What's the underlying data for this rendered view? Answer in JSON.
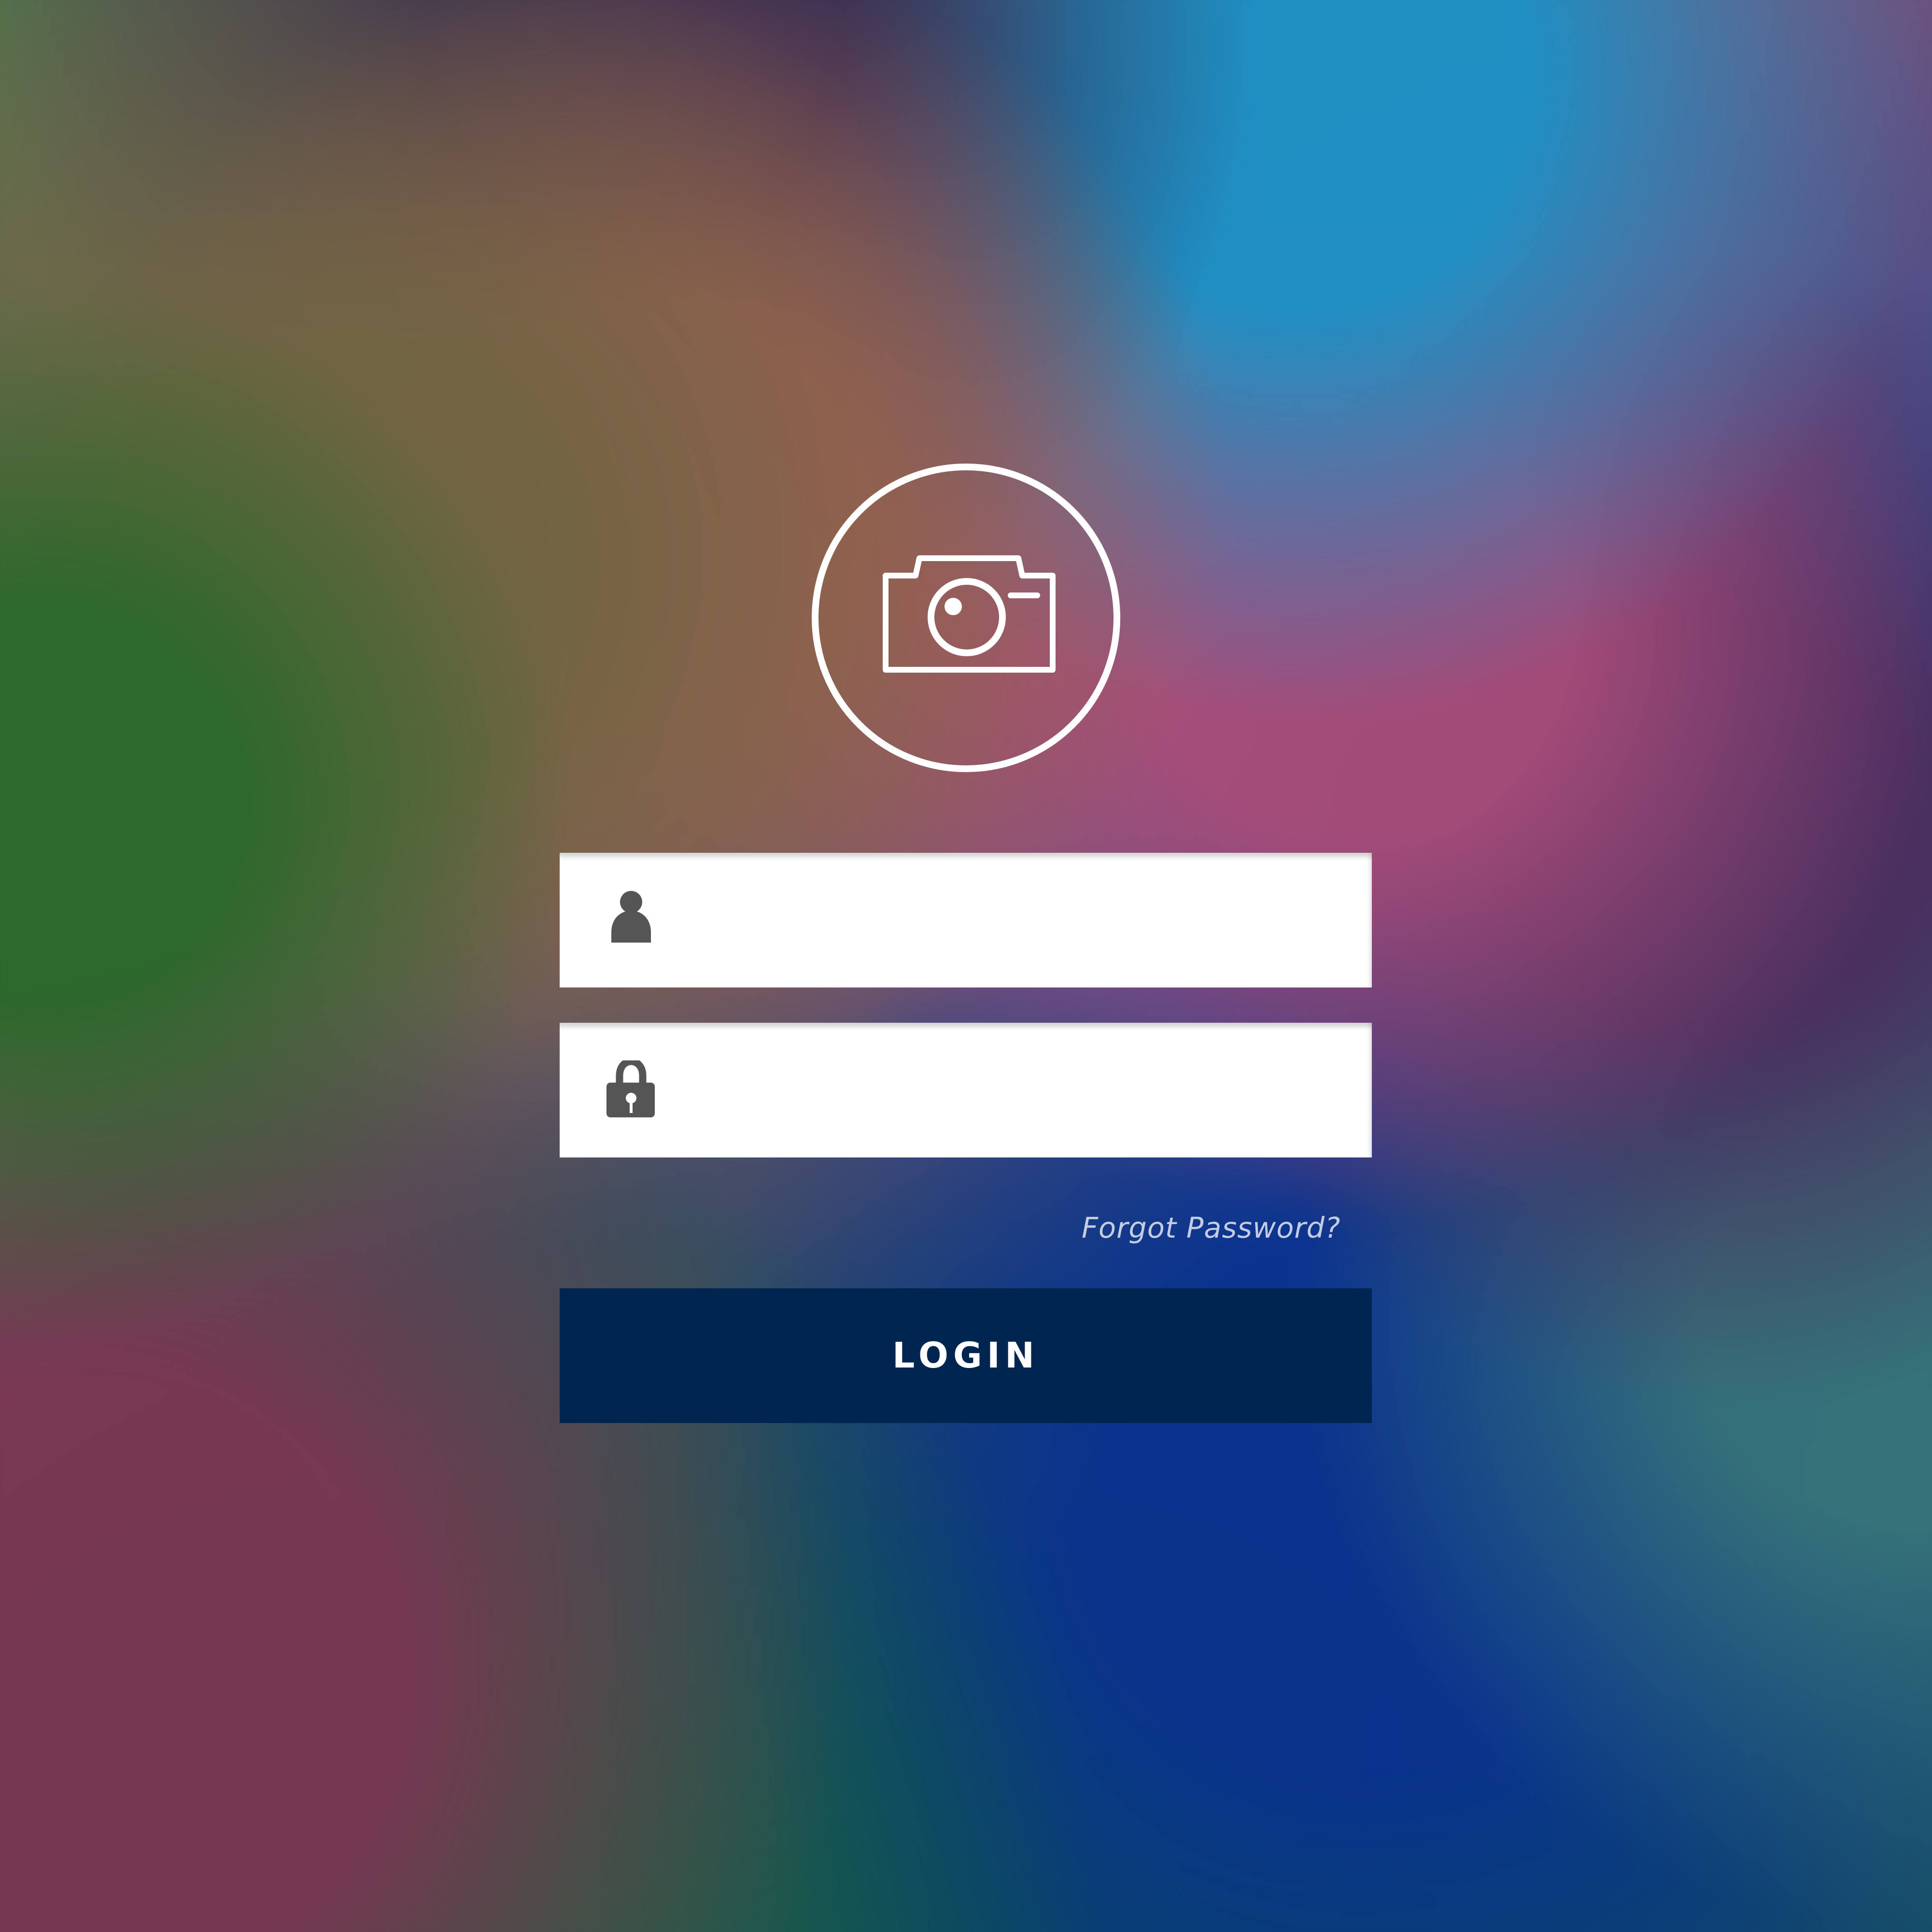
{
  "app": {
    "brand_icon": "camera-icon",
    "background_theme": "blurred multicolor gradient"
  },
  "login_form": {
    "username": {
      "icon": "user-icon",
      "value": "",
      "placeholder": ""
    },
    "password": {
      "icon": "lock-icon",
      "value": "",
      "placeholder": ""
    },
    "forgot_password_label": "Forgot Password?",
    "submit_label": "LOGIN"
  },
  "colors": {
    "button": "#00254f",
    "field": "#ffffff",
    "text": "#ffffff",
    "icon": "#5b5b5b"
  }
}
